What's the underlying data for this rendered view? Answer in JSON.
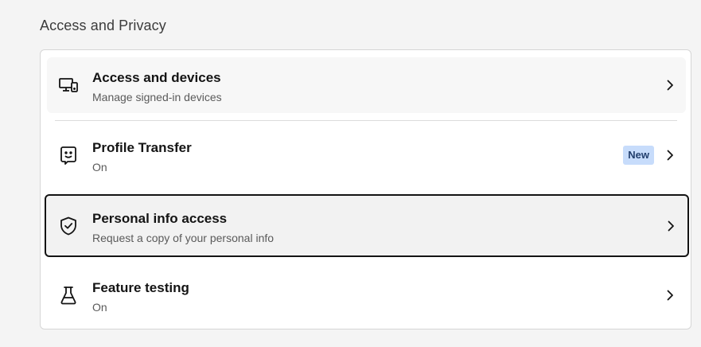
{
  "section": {
    "title": "Access and Privacy"
  },
  "items": [
    {
      "label": "Access and devices",
      "subtitle": "Manage signed-in devices",
      "icon": "devices-icon"
    },
    {
      "label": "Profile Transfer",
      "subtitle": "On",
      "icon": "profile-transfer-icon",
      "badge": "New"
    },
    {
      "label": "Personal info access",
      "subtitle": "Request a copy of your personal info",
      "icon": "shield-check-icon",
      "focused": true
    },
    {
      "label": "Feature testing",
      "subtitle": "On",
      "icon": "flask-icon"
    }
  ],
  "colors": {
    "background": "#f4f4f4",
    "card": "#ffffff",
    "badge_bg": "#c7dcfb",
    "badge_text": "#23406e",
    "focus_border": "#141414"
  }
}
